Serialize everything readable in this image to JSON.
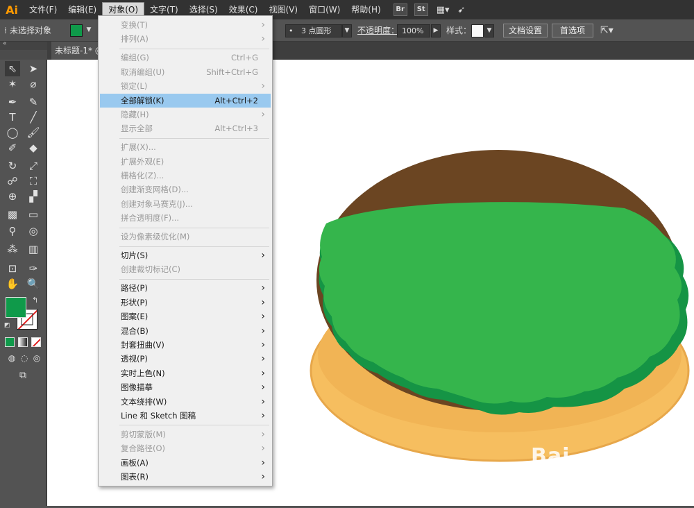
{
  "app": {
    "logo": "Ai"
  },
  "menubar": {
    "items": [
      "文件(F)",
      "编辑(E)",
      "对象(O)",
      "文字(T)",
      "选择(S)",
      "效果(C)",
      "视图(V)",
      "窗口(W)",
      "帮助(H)"
    ],
    "active_index": 2,
    "bridge": "Br",
    "stock": "St"
  },
  "options": {
    "no_selection": "未选择对象",
    "stroke_preset": "3 点圆形",
    "opacity_label": "不透明度：",
    "opacity_value": "100%",
    "style_label": "样式：",
    "doc_setup": "文档设置",
    "preferences": "首选项"
  },
  "document": {
    "tab_title": "未标题-1* @"
  },
  "object_menu": [
    {
      "label": "变换(T)",
      "shortcut": "",
      "submenu": true,
      "enabled": false
    },
    {
      "label": "排列(A)",
      "shortcut": "",
      "submenu": true,
      "enabled": false
    },
    {
      "sep": true
    },
    {
      "label": "编组(G)",
      "shortcut": "Ctrl+G",
      "submenu": false,
      "enabled": false
    },
    {
      "label": "取消编组(U)",
      "shortcut": "Shift+Ctrl+G",
      "submenu": false,
      "enabled": false
    },
    {
      "label": "锁定(L)",
      "shortcut": "",
      "submenu": true,
      "enabled": false
    },
    {
      "label": "全部解锁(K)",
      "shortcut": "Alt+Ctrl+2",
      "submenu": false,
      "enabled": true,
      "highlighted": true
    },
    {
      "label": "隐藏(H)",
      "shortcut": "",
      "submenu": true,
      "enabled": false
    },
    {
      "label": "显示全部",
      "shortcut": "Alt+Ctrl+3",
      "submenu": false,
      "enabled": false
    },
    {
      "sep": true
    },
    {
      "label": "扩展(X)...",
      "shortcut": "",
      "submenu": false,
      "enabled": false
    },
    {
      "label": "扩展外观(E)",
      "shortcut": "",
      "submenu": false,
      "enabled": false
    },
    {
      "label": "栅格化(Z)...",
      "shortcut": "",
      "submenu": false,
      "enabled": false
    },
    {
      "label": "创建渐变网格(D)...",
      "shortcut": "",
      "submenu": false,
      "enabled": false
    },
    {
      "label": "创建对象马赛克(J)...",
      "shortcut": "",
      "submenu": false,
      "enabled": false
    },
    {
      "label": "拼合透明度(F)...",
      "shortcut": "",
      "submenu": false,
      "enabled": false
    },
    {
      "sep": true
    },
    {
      "label": "设为像素级优化(M)",
      "shortcut": "",
      "submenu": false,
      "enabled": false
    },
    {
      "sep": true
    },
    {
      "label": "切片(S)",
      "shortcut": "",
      "submenu": true,
      "enabled": true
    },
    {
      "label": "创建裁切标记(C)",
      "shortcut": "",
      "submenu": false,
      "enabled": false
    },
    {
      "sep": true
    },
    {
      "label": "路径(P)",
      "shortcut": "",
      "submenu": true,
      "enabled": true
    },
    {
      "label": "形状(P)",
      "shortcut": "",
      "submenu": true,
      "enabled": true
    },
    {
      "label": "图案(E)",
      "shortcut": "",
      "submenu": true,
      "enabled": true
    },
    {
      "label": "混合(B)",
      "shortcut": "",
      "submenu": true,
      "enabled": true
    },
    {
      "label": "封套扭曲(V)",
      "shortcut": "",
      "submenu": true,
      "enabled": true
    },
    {
      "label": "透视(P)",
      "shortcut": "",
      "submenu": true,
      "enabled": true
    },
    {
      "label": "实时上色(N)",
      "shortcut": "",
      "submenu": true,
      "enabled": true
    },
    {
      "label": "图像描摹",
      "shortcut": "",
      "submenu": true,
      "enabled": true
    },
    {
      "label": "文本绕排(W)",
      "shortcut": "",
      "submenu": true,
      "enabled": true
    },
    {
      "label": "Line 和 Sketch 图稿",
      "shortcut": "",
      "submenu": true,
      "enabled": true
    },
    {
      "sep": true
    },
    {
      "label": "剪切蒙版(M)",
      "shortcut": "",
      "submenu": true,
      "enabled": false
    },
    {
      "label": "复合路径(O)",
      "shortcut": "",
      "submenu": true,
      "enabled": false
    },
    {
      "label": "画板(A)",
      "shortcut": "",
      "submenu": true,
      "enabled": true
    },
    {
      "label": "图表(R)",
      "shortcut": "",
      "submenu": true,
      "enabled": true
    }
  ],
  "colors": {
    "fill": "#0f9a4a",
    "icing": "#35b54c",
    "icing_shadow": "#159445",
    "chocolate": "#6b4522",
    "biscuit": "#f6be5f",
    "biscuit_edge": "#e7a74a",
    "menu_highlight": "#99c9ef"
  },
  "watermark": "Bai"
}
